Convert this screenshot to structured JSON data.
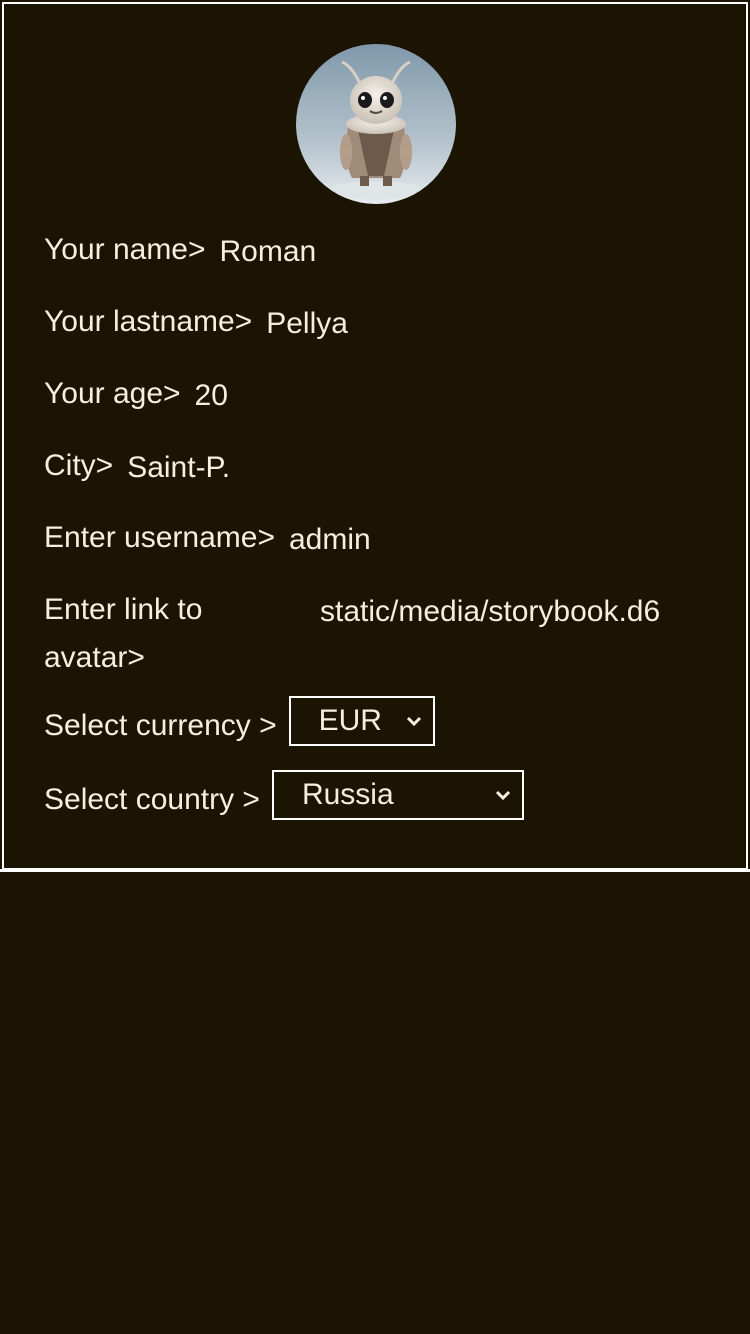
{
  "profile": {
    "name_label": "Your name>",
    "name_value": "Roman",
    "lastname_label": "Your lastname>",
    "lastname_value": "Pellya",
    "age_label": "Your age>",
    "age_value": "20",
    "city_label": "City>",
    "city_value": "Saint-P.",
    "username_label": "Enter username>",
    "username_value": "admin",
    "avatar_label": "Enter link to avatar>",
    "avatar_value": "static/media/storybook.d6"
  },
  "currency": {
    "label": "Select currency >",
    "selected": "EUR"
  },
  "country": {
    "label": "Select country >",
    "selected": "Russia"
  },
  "colors": {
    "background": "#1c1403",
    "text": "#f5efe0",
    "border": "#ffffff"
  },
  "icons": {
    "avatar": "avatar-image",
    "dropdown": "chevron-down-icon"
  }
}
